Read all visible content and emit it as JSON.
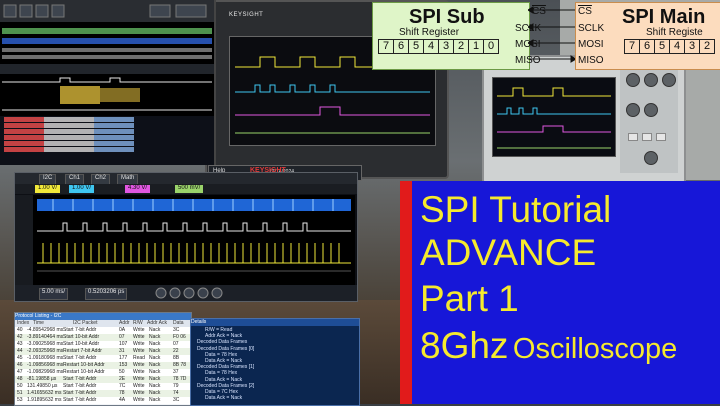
{
  "spi_sub": {
    "title": "SPI Sub",
    "subtitle": "Shift Register",
    "bits": [
      "7",
      "6",
      "5",
      "4",
      "3",
      "2",
      "1",
      "0"
    ],
    "pins": {
      "cs": "CS",
      "sclk": "SCLK",
      "mosi": "MOSI",
      "miso": "MISO"
    }
  },
  "spi_main": {
    "title": "SPI Main",
    "subtitle": "Shift Registe",
    "bits": [
      "7",
      "6",
      "5",
      "4",
      "3",
      "2"
    ],
    "pins": {
      "cs": "CS",
      "sclk": "SCLK",
      "mosi": "MOSI",
      "miso": "MISO"
    }
  },
  "title_card": {
    "line1": "SPI Tutorial",
    "line2": "ADVANCE",
    "line3": "Part 1",
    "line4_a": "8Ghz",
    "line4_b": "Oscilloscope"
  },
  "scope_ui": {
    "brand": "KEYSIGHT",
    "menu_help": "Help",
    "tabs": [
      "I2C",
      "Ch1",
      "Ch2",
      "Math"
    ],
    "channels": [
      "1.00 V/",
      "1.00 V/",
      "4.30 V/",
      "500 mV/"
    ],
    "timebase": "5.00 ms/",
    "delay": "0.5203206 ps",
    "date": "12/14/2024"
  },
  "decode_table": {
    "title": "Protocol Listing - I2C",
    "columns": [
      "Index",
      "Time",
      "I2C Packet",
      "Addr",
      "R/W",
      "Addr Ack",
      "Data"
    ],
    "rows": [
      [
        "40",
        "-4.89542968 ms",
        "Start 7-bit Addr",
        "0A",
        "Write",
        "Nack",
        "3C"
      ],
      [
        "42",
        "-3.89140464 ms",
        "Start 10-bit Addr",
        "07",
        "Write",
        "Nack",
        "F0 06"
      ],
      [
        "43",
        "-3.09025968 ms",
        "Start 10-bit Addr",
        "107",
        "Write",
        "Nack",
        "07"
      ],
      [
        "44",
        "-2.09325968 ms",
        "Restart 7-bit Addr",
        "31",
        "Write",
        "Nack",
        "22"
      ],
      [
        "45",
        "-1.09180968 ms",
        "Start 7-bit Addr",
        "177",
        "Read",
        "Nack",
        "8B"
      ],
      [
        "46",
        "-1.09856968 ms",
        "Restart 10-bit Addr",
        "153",
        "Write",
        "Nack",
        "8B 78"
      ],
      [
        "47",
        "-1.09829968 ms",
        "Restart 10-bit Addr",
        "50",
        "Write",
        "Nack",
        "37"
      ],
      [
        "48",
        "-81.19858 µs",
        "Start 7-bit Addr",
        "2E",
        "Write",
        "Nack",
        "78 7D"
      ],
      [
        "50",
        "131.49850 µs",
        "Start 7-bit Addr",
        "7C",
        "Write",
        "Nack",
        "79"
      ],
      [
        "51",
        "1.41655632 ms",
        "Start 7-bit Addr",
        "78",
        "Write",
        "Nack",
        "74"
      ],
      [
        "53",
        "1.91895632 ms",
        "Start 7-bit Addr",
        "4A",
        "Write",
        "Nack",
        "3C"
      ]
    ]
  },
  "details": {
    "title": "Details",
    "lines": [
      "R/W = Read",
      "Addr Ack = Nack",
      "Decoded Data Frames",
      "Decoded Data Frames [0]",
      "Data = 78 Hex",
      "Data Ack = Nack",
      "Decoded Data Frames [1]",
      "Data = 78 Hex",
      "Data Ack = Nack",
      "Decoded Data Frames [2]",
      "Data = 7C Hex",
      "Data Ack = Nack"
    ]
  },
  "colors": {
    "title_bg": "#1717d8",
    "title_text": "#f6ea2d",
    "title_stripe": "#e11b1b",
    "sub_box": "#dff5c8",
    "main_box": "#fcdcbe",
    "trace_yellow": "#f1e93a",
    "trace_cyan": "#3fc6f0"
  }
}
